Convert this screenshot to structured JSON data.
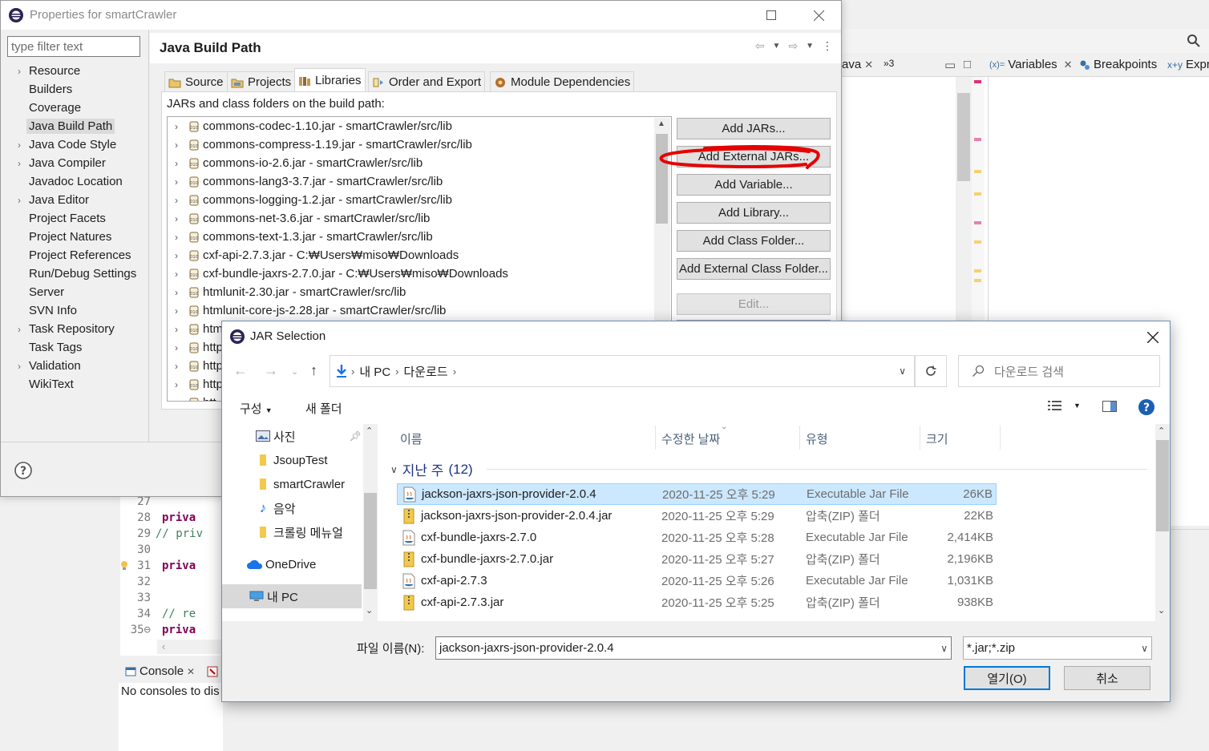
{
  "workbench": {
    "right_tabs": [
      {
        "label": "ava",
        "closable": true
      },
      {
        "label": "»3"
      }
    ],
    "view_tabs": [
      {
        "label": "Variables",
        "closable": true
      },
      {
        "label": "Breakpoints"
      },
      {
        "label": "Expre"
      }
    ],
    "code_lines": [
      {
        "num": "27",
        "text": ""
      },
      {
        "num": "28",
        "text": "priva"
      },
      {
        "num": "29",
        "text": "//  priv"
      },
      {
        "num": "30",
        "text": ""
      },
      {
        "num": "31",
        "text": "priva"
      },
      {
        "num": "32",
        "text": ""
      },
      {
        "num": "33",
        "text": ""
      },
      {
        "num": "34",
        "text": "// re"
      },
      {
        "num": "35⊖",
        "text": "priva"
      }
    ],
    "console_tab": "Console",
    "console_message": "No consoles to dis"
  },
  "props": {
    "title": "Properties for smartCrawler",
    "filter_placeholder": "type filter text",
    "tree": [
      {
        "label": "Resource",
        "expandable": true
      },
      {
        "label": "Builders",
        "expandable": false
      },
      {
        "label": "Coverage",
        "expandable": false
      },
      {
        "label": "Java Build Path",
        "expandable": false,
        "selected": true
      },
      {
        "label": "Java Code Style",
        "expandable": true
      },
      {
        "label": "Java Compiler",
        "expandable": true
      },
      {
        "label": "Javadoc Location",
        "expandable": false
      },
      {
        "label": "Java Editor",
        "expandable": true
      },
      {
        "label": "Project Facets",
        "expandable": false
      },
      {
        "label": "Project Natures",
        "expandable": false
      },
      {
        "label": "Project References",
        "expandable": false
      },
      {
        "label": "Run/Debug Settings",
        "expandable": false
      },
      {
        "label": "Server",
        "expandable": false
      },
      {
        "label": "SVN Info",
        "expandable": false
      },
      {
        "label": "Task Repository",
        "expandable": true
      },
      {
        "label": "Task Tags",
        "expandable": false
      },
      {
        "label": "Validation",
        "expandable": true
      },
      {
        "label": "WikiText",
        "expandable": false
      }
    ],
    "page_title": "Java Build Path",
    "tabs": [
      {
        "label": "Source"
      },
      {
        "label": "Projects"
      },
      {
        "label": "Libraries",
        "active": true
      },
      {
        "label": "Order and Export"
      },
      {
        "label": "Module Dependencies"
      }
    ],
    "jars_label": "JARs and class folders on the build path:",
    "jars": [
      "commons-codec-1.10.jar - smartCrawler/src/lib",
      "commons-compress-1.19.jar - smartCrawler/src/lib",
      "commons-io-2.6.jar - smartCrawler/src/lib",
      "commons-lang3-3.7.jar - smartCrawler/src/lib",
      "commons-logging-1.2.jar - smartCrawler/src/lib",
      "commons-net-3.6.jar - smartCrawler/src/lib",
      "commons-text-1.3.jar - smartCrawler/src/lib",
      "cxf-api-2.7.3.jar - C:₩Users₩miso₩Downloads",
      "cxf-bundle-jaxrs-2.7.0.jar - C:₩Users₩miso₩Downloads",
      "htmlunit-2.30.jar - smartCrawler/src/lib",
      "htmlunit-core-js-2.28.jar - smartCrawler/src/lib",
      "htm",
      "http",
      "http",
      "http",
      "htt"
    ],
    "buttons": [
      {
        "label": "Add JARs...",
        "enabled": true
      },
      {
        "label": "Add External JARs...",
        "enabled": true,
        "highlighted": true
      },
      {
        "label": "Add Variable...",
        "enabled": true
      },
      {
        "label": "Add Library...",
        "enabled": true
      },
      {
        "label": "Add Class Folder...",
        "enabled": true
      },
      {
        "label": "Add External Class Folder...",
        "enabled": true
      },
      {
        "label": "Edit...",
        "enabled": false
      }
    ],
    "highlight_color": "#e60000"
  },
  "jarsel": {
    "title": "JAR Selection",
    "breadcrumb": [
      "내 PC",
      "다운로드"
    ],
    "search_placeholder": "다운로드 검색",
    "toolbar": {
      "organize": "구성",
      "new_folder": "새 폴더"
    },
    "nav": [
      {
        "label": "사진",
        "icon": "pictures-icon",
        "pinned": true
      },
      {
        "label": "JsoupTest",
        "icon": "folder-icon"
      },
      {
        "label": "smartCrawler",
        "icon": "folder-icon"
      },
      {
        "label": "음악",
        "icon": "music-icon"
      },
      {
        "label": "크롤링 메뉴얼",
        "icon": "folder-icon"
      },
      {
        "label": "OneDrive",
        "icon": "onedrive-icon"
      },
      {
        "label": "내 PC",
        "icon": "pc-icon",
        "selected": true
      }
    ],
    "columns": {
      "name": "이름",
      "modified": "수정한 날짜",
      "type": "유형",
      "size": "크기"
    },
    "group": {
      "label": "지난 주",
      "count": "(12)"
    },
    "files": [
      {
        "name": "jackson-jaxrs-json-provider-2.0.4",
        "date": "2020-11-25 오후 5:29",
        "type": "Executable Jar File",
        "size": "26KB",
        "kind": "exec",
        "selected": true
      },
      {
        "name": "jackson-jaxrs-json-provider-2.0.4.jar",
        "date": "2020-11-25 오후 5:29",
        "type": "압축(ZIP) 폴더",
        "size": "22KB",
        "kind": "zip"
      },
      {
        "name": "cxf-bundle-jaxrs-2.7.0",
        "date": "2020-11-25 오후 5:28",
        "type": "Executable Jar File",
        "size": "2,414KB",
        "kind": "exec"
      },
      {
        "name": "cxf-bundle-jaxrs-2.7.0.jar",
        "date": "2020-11-25 오후 5:27",
        "type": "압축(ZIP) 폴더",
        "size": "2,196KB",
        "kind": "zip"
      },
      {
        "name": "cxf-api-2.7.3",
        "date": "2020-11-25 오후 5:26",
        "type": "Executable Jar File",
        "size": "1,031KB",
        "kind": "exec"
      },
      {
        "name": "cxf-api-2.7.3.jar",
        "date": "2020-11-25 오후 5:25",
        "type": "압축(ZIP) 폴더",
        "size": "938KB",
        "kind": "zip"
      }
    ],
    "filename_label": "파일 이름(N):",
    "filename_value": "jackson-jaxrs-json-provider-2.0.4",
    "filetype_value": "*.jar;*.zip",
    "open_label": "열기(O)",
    "cancel_label": "취소",
    "accent": "#0078d7"
  }
}
